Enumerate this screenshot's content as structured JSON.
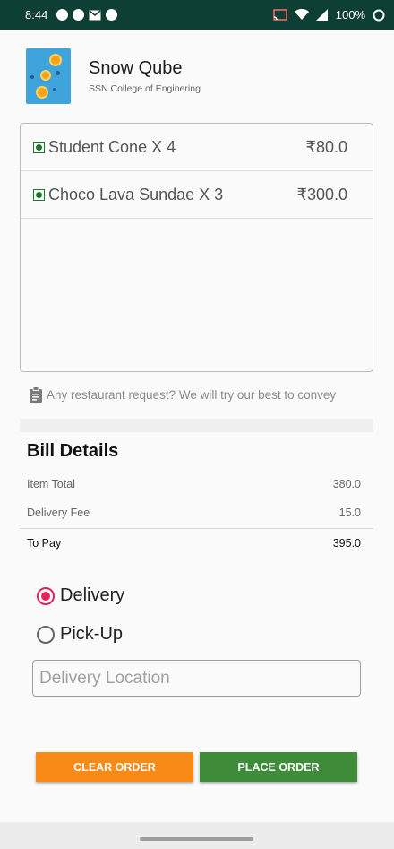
{
  "status_bar": {
    "time": "8:44",
    "battery": "100%"
  },
  "restaurant": {
    "name": "Snow Qube",
    "location": "SSN College of Enginering"
  },
  "cart": {
    "items": [
      {
        "name": "Student Cone X 4",
        "price": "₹80.0",
        "veg": true
      },
      {
        "name": "Choco Lava Sundae X 3",
        "price": "₹300.0",
        "veg": true
      }
    ]
  },
  "request_hint": "Any restaurant request? We will try our best to convey",
  "bill": {
    "title": "Bill Details",
    "item_total_label": "Item Total",
    "item_total_value": "380.0",
    "delivery_fee_label": "Delivery Fee",
    "delivery_fee_value": "15.0",
    "to_pay_label": "To Pay",
    "to_pay_value": "395.0"
  },
  "order_type": {
    "options": [
      "Delivery",
      "Pick-Up"
    ],
    "selected": "Delivery"
  },
  "location_input": {
    "placeholder": "Delivery Location",
    "value": ""
  },
  "actions": {
    "clear_label": "CLEAR ORDER",
    "place_label": "PLACE ORDER"
  },
  "colors": {
    "status_bar": "#0d3f34",
    "radio_accent": "#e2245a",
    "clear_button": "#f98a16",
    "place_button": "#3e8c39",
    "veg_mark": "#1b7a2b"
  }
}
